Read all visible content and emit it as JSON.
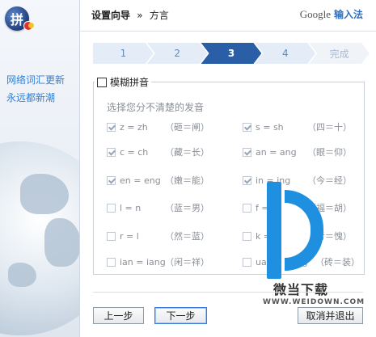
{
  "sidebar": {
    "logo_char": "拼",
    "slogan_line1": "网络词汇更新",
    "slogan_line2": "永远都新潮"
  },
  "header": {
    "breadcrumb_root": "设置向导",
    "breadcrumb_sep": "»",
    "breadcrumb_current": "方言",
    "brand_google": "Google",
    "brand_ime": "输入法"
  },
  "steps": [
    "1",
    "2",
    "3",
    "4",
    "完成"
  ],
  "active_step": 3,
  "fuzzy": {
    "title": "模糊拼音",
    "title_checked": false,
    "hint": "选择您分不清楚的发音",
    "rows": [
      {
        "left": {
          "label": "z = zh",
          "example": "（砸＝闸）",
          "checked": true
        },
        "right": {
          "label": "s = sh",
          "example": "（四＝十）",
          "checked": true
        }
      },
      {
        "left": {
          "label": "c = ch",
          "example": "（藏＝长）",
          "checked": true
        },
        "right": {
          "label": "an = ang",
          "example": "（眼＝仰）",
          "checked": true
        }
      },
      {
        "left": {
          "label": "en = eng",
          "example": "（嫩＝能）",
          "checked": true
        },
        "right": {
          "label": "in = ing",
          "example": "（今＝经）",
          "checked": true
        }
      },
      {
        "left": {
          "label": "l = n",
          "example": "（蓝＝男）",
          "checked": false
        },
        "right": {
          "label": "f = h",
          "example": "（福＝胡）",
          "checked": false
        }
      },
      {
        "left": {
          "label": "r = l",
          "example": "（然＝蓝）",
          "checked": false
        },
        "right": {
          "label": "k = g",
          "example": "（亏＝愧）",
          "checked": false
        }
      },
      {
        "left": {
          "label": "ian = iang",
          "example": "（闲＝祥）",
          "checked": false
        },
        "right": {
          "label": "uan = uang",
          "example": "（砖＝装）",
          "checked": false
        }
      }
    ]
  },
  "buttons": {
    "prev": "上一步",
    "next": "下一步",
    "cancel": "取消并退出"
  },
  "watermark": {
    "text": "微当下载",
    "url": "WWW.WEIDOWN.COM"
  },
  "colors": {
    "accent": "#2a5fa7",
    "sidebar_text": "#2f7fd6",
    "step_inactive": "#e3ecf7",
    "watermark_blue": "#1f8fe0"
  }
}
